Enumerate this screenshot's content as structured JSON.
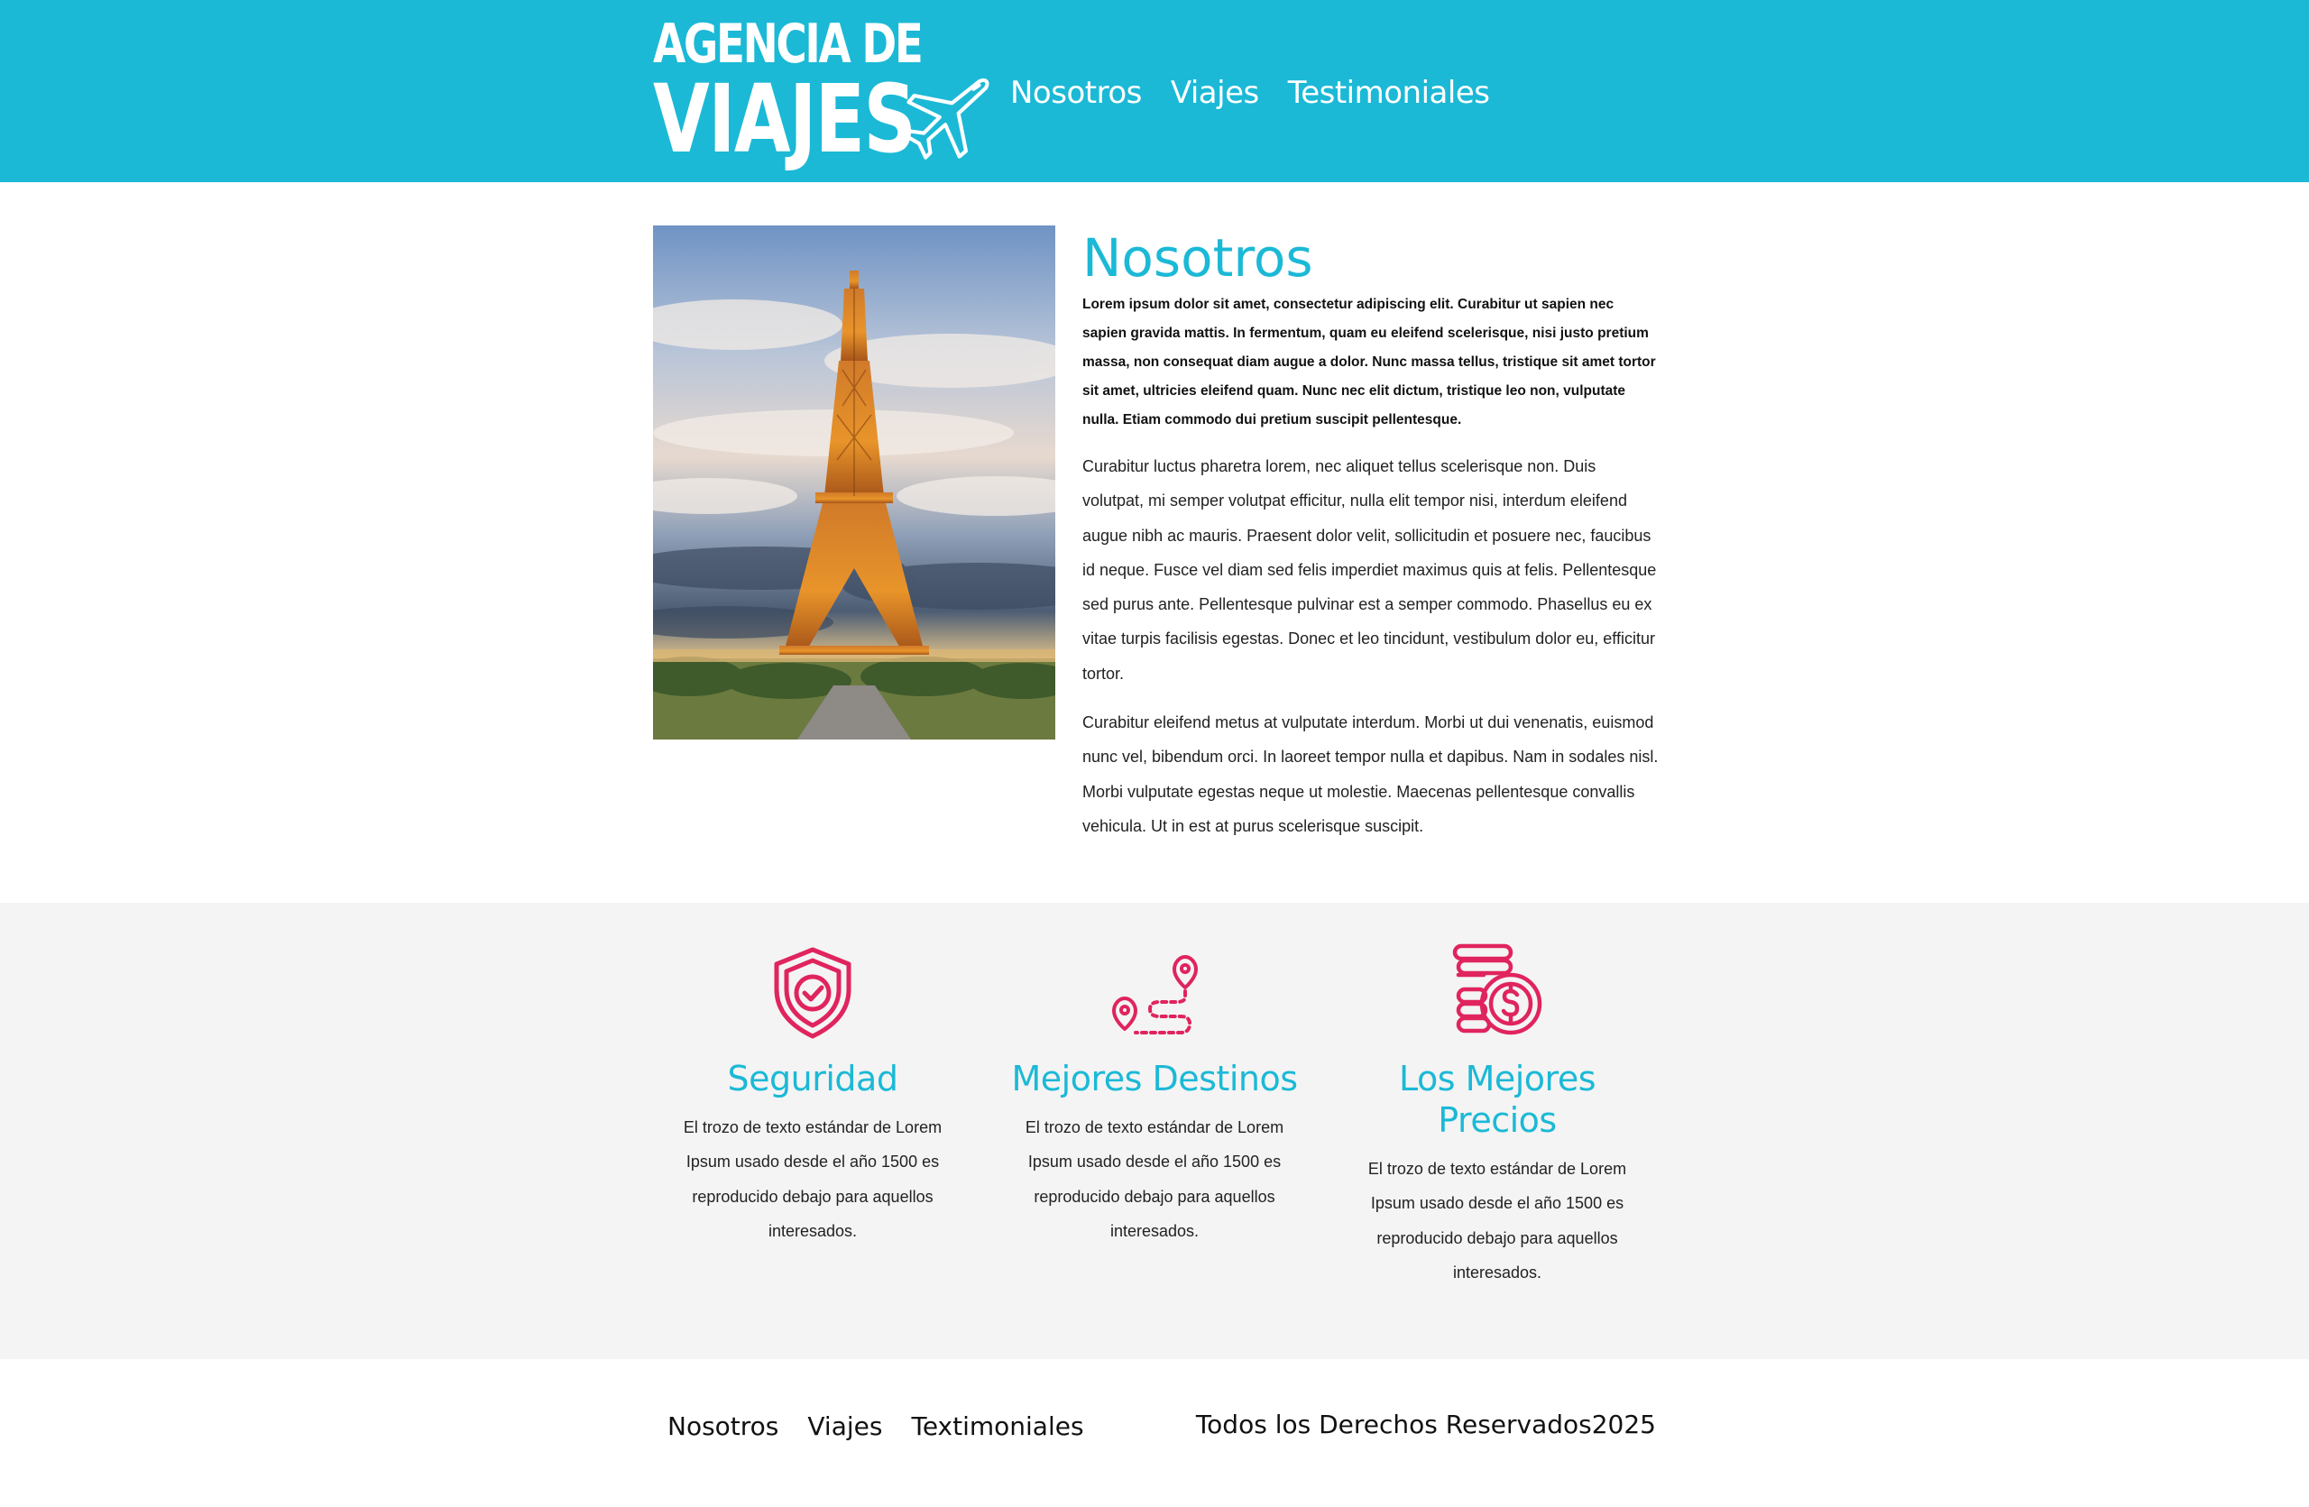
{
  "brand": {
    "logo_line1": "AGENCIA DE",
    "logo_line2": "VIAJES",
    "primary_color": "#1bb9d6",
    "accent_color": "#e0245e"
  },
  "nav": {
    "items": [
      {
        "label": "Nosotros"
      },
      {
        "label": "Viajes"
      },
      {
        "label": "Testimoniales"
      }
    ]
  },
  "about": {
    "image_subject": "eiffel-tower-photo",
    "title": "Nosotros",
    "lead": "Lorem ipsum dolor sit amet, consectetur adipiscing elit. Curabitur ut sapien nec sapien gravida mattis. In fermentum, quam eu eleifend scelerisque, nisi justo pretium massa, non consequat diam augue a dolor. Nunc massa tellus, tristique sit amet tortor sit amet, ultricies eleifend quam. Nunc nec elit dictum, tristique leo non, vulputate nulla. Etiam commodo dui pretium suscipit pellentesque.",
    "paragraphs": [
      "Curabitur luctus pharetra lorem, nec aliquet tellus scelerisque non. Duis volutpat, mi semper volutpat efficitur, nulla elit tempor nisi, interdum eleifend augue nibh ac mauris. Praesent dolor velit, sollicitudin et posuere nec, faucibus id neque. Fusce vel diam sed felis imperdiet maximus quis at felis. Pellentesque sed purus ante. Pellentesque pulvinar est a semper commodo. Phasellus eu ex vitae turpis facilisis egestas. Donec et leo tincidunt, vestibulum dolor eu, efficitur tortor.",
      "Curabitur eleifend metus at vulputate interdum. Morbi ut dui venenatis, euismod nunc vel, bibendum orci. In laoreet tempor nulla et dapibus. Nam in sodales nisl. Morbi vulputate egestas neque ut molestie. Maecenas pellentesque convallis vehicula. Ut in est at purus scelerisque suscipit."
    ]
  },
  "features": [
    {
      "icon": "shield-check-icon",
      "title": "Seguridad",
      "text": "El trozo de texto estándar de Lorem Ipsum usado desde el año 1500 es reproducido debajo para aquellos interesados."
    },
    {
      "icon": "route-map-pins-icon",
      "title": "Mejores Destinos",
      "text": "El trozo de texto estándar de Lorem Ipsum usado desde el año 1500 es reproducido debajo para aquellos interesados."
    },
    {
      "icon": "coins-dollar-icon",
      "title": "Los Mejores Precios",
      "text": "El trozo de texto estándar de Lorem Ipsum usado desde el año 1500 es reproducido debajo para aquellos interesados."
    }
  ],
  "footer": {
    "nav": [
      {
        "label": "Nosotros"
      },
      {
        "label": "Viajes"
      },
      {
        "label": "Textimoniales"
      }
    ],
    "copyright": "Todos los Derechos Reservados2025"
  }
}
